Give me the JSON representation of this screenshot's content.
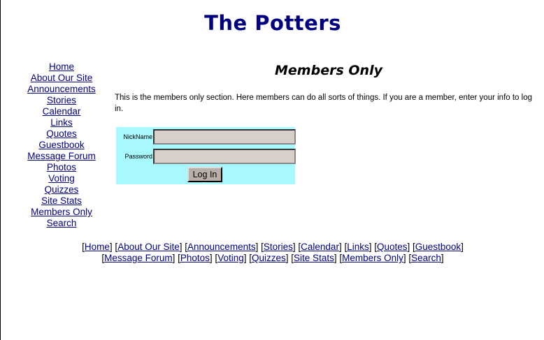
{
  "site": {
    "title": "The Potters"
  },
  "nav": {
    "items": [
      {
        "label": "Home"
      },
      {
        "label": "About Our Site"
      },
      {
        "label": "Announcements"
      },
      {
        "label": "Stories"
      },
      {
        "label": "Calendar"
      },
      {
        "label": "Links"
      },
      {
        "label": "Quotes"
      },
      {
        "label": "Guestbook"
      },
      {
        "label": "Message Forum"
      },
      {
        "label": "Photos"
      },
      {
        "label": "Voting"
      },
      {
        "label": "Quizzes"
      },
      {
        "label": "Site Stats"
      },
      {
        "label": "Members Only"
      },
      {
        "label": "Search"
      }
    ]
  },
  "main": {
    "heading": "Members Only",
    "intro": "This is the members only section. Here members can do all sorts of things. If you are a member, enter your info to log in."
  },
  "login": {
    "nickname_label": "NickName",
    "nickname_value": "",
    "password_label": "Password",
    "password_value": "",
    "button_label": "Log In",
    "bg_color": "#a8f8ff"
  }
}
